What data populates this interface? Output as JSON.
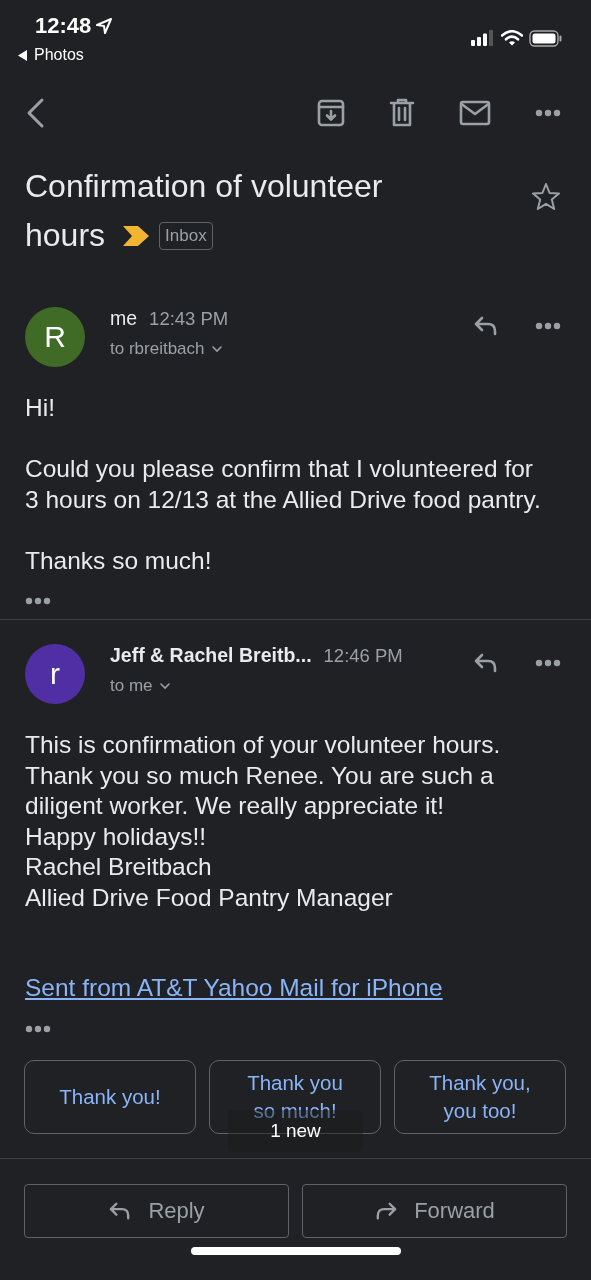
{
  "status_bar": {
    "time": "12:48",
    "back_app": "Photos"
  },
  "subject": {
    "lines": [
      "Confirmation of volunteer",
      "hours"
    ],
    "important": true,
    "label": "Inbox",
    "starred": false
  },
  "messages": [
    {
      "avatar_letter": "R",
      "color": "#3f6b26",
      "sender": "me",
      "sender_bold": false,
      "time": "12:43 PM",
      "recipient": "to rbreitbach",
      "paragraphs": [
        [
          "Hi!"
        ],
        [
          "Could you please confirm that I volunteered for",
          "3 hours on 12/13 at the Allied Drive food pantry."
        ],
        [
          "Thanks so much!"
        ]
      ]
    },
    {
      "avatar_letter": "r",
      "color": "#4f2fa3",
      "sender": "Jeff & Rachel Breitb...",
      "sender_bold": true,
      "time": "12:46 PM",
      "recipient": "to me",
      "paragraphs": [
        [
          "This is confirmation of your volunteer hours.",
          "Thank you so much Renee. You are such a",
          "diligent worker. We really appreciate it!",
          "Happy holidays!!",
          "Rachel Breitbach",
          "Allied Drive Food Pantry Manager"
        ]
      ],
      "link": "Sent from AT&T Yahoo Mail for iPhone"
    }
  ],
  "smart_replies": [
    [
      "Thank you!"
    ],
    [
      "Thank you",
      "so much!"
    ],
    [
      "Thank you,",
      "you too!"
    ]
  ],
  "toast": "1 new",
  "actions": [
    {
      "kind": "reply",
      "label": "Reply"
    },
    {
      "kind": "forward",
      "label": "Forward"
    }
  ]
}
